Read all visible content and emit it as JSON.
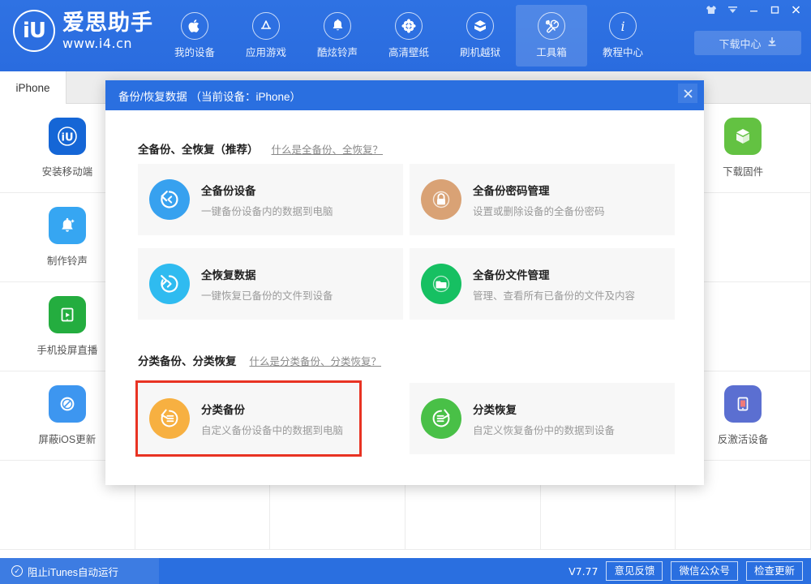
{
  "window": {
    "controls": [
      {
        "name": "skin-icon",
        "label": "皮肤"
      },
      {
        "name": "menu-icon",
        "label": "菜单"
      },
      {
        "name": "minimize-icon",
        "label": "最小化"
      },
      {
        "name": "maximize-icon",
        "label": "最大化"
      },
      {
        "name": "close-icon",
        "label": "关闭"
      }
    ]
  },
  "header": {
    "logo_mark": "iU",
    "brand_cn": "爱思助手",
    "brand_url": "www.i4.cn",
    "nav": [
      {
        "label": "我的设备",
        "icon": "apple-icon",
        "active": false
      },
      {
        "label": "应用游戏",
        "icon": "appstore-icon",
        "active": false
      },
      {
        "label": "酷炫铃声",
        "icon": "bell-icon",
        "active": false
      },
      {
        "label": "高清壁纸",
        "icon": "flower-icon",
        "active": false
      },
      {
        "label": "刷机越狱",
        "icon": "box-open-icon",
        "active": false
      },
      {
        "label": "工具箱",
        "icon": "tools-icon",
        "active": true
      },
      {
        "label": "教程中心",
        "icon": "info-icon",
        "active": false
      }
    ],
    "download_center": "下载中心",
    "download_icon": "download-icon",
    "accent_color": "#2a6fe0"
  },
  "tabs": [
    {
      "label": "iPhone",
      "active": true
    }
  ],
  "toolbox": {
    "tiles": [
      {
        "label": "安装移动端",
        "icon": "i4-app-icon",
        "color": "#1566d6",
        "pos": 0
      },
      {
        "label": "下载固件",
        "icon": "firmware-cube-icon",
        "color": "#63c242",
        "pos": 5
      },
      {
        "label": "制作铃声",
        "icon": "ringtone-bell-icon",
        "color": "#36a6f2",
        "pos": 6
      },
      {
        "label": "手机投屏直播",
        "icon": "screen-cast-icon",
        "color": "#24ad3f",
        "pos": 12
      },
      {
        "label": "屏蔽iOS更新",
        "icon": "block-update-icon",
        "color": "#3d96f0",
        "pos": 18
      },
      {
        "label": "反激活设备",
        "icon": "deactivate-device-icon",
        "color": "#5b6fd1",
        "pos": 23
      }
    ]
  },
  "dialog": {
    "title": "备份/恢复数据  （当前设备：iPhone）",
    "close_icon": "close-icon",
    "sections": [
      {
        "title": "全备份、全恢复（推荐）",
        "link": "什么是全备份、全恢复？",
        "cards": [
          {
            "title": "全备份设备",
            "desc": "一键备份设备内的数据到电脑",
            "icon": "backup-arrow-icon",
            "color": "#37a1ef",
            "highlighted": false
          },
          {
            "title": "全备份密码管理",
            "desc": "设置或删除设备的全备份密码",
            "icon": "lock-icon",
            "color": "#d9a275",
            "highlighted": false
          },
          {
            "title": "全恢复数据",
            "desc": "一键恢复已备份的文件到设备",
            "icon": "restore-arrow-icon",
            "color": "#2fbbf0",
            "highlighted": false
          },
          {
            "title": "全备份文件管理",
            "desc": "管理、查看所有已备份的文件及内容",
            "icon": "folder-icon",
            "color": "#16c062",
            "highlighted": false
          }
        ]
      },
      {
        "title": "分类备份、分类恢复",
        "link": "什么是分类备份、分类恢复？",
        "cards": [
          {
            "title": "分类备份",
            "desc": "自定义备份设备中的数据到电脑",
            "icon": "category-backup-icon",
            "color": "#f7b041",
            "highlighted": true
          },
          {
            "title": "分类恢复",
            "desc": "自定义恢复备份中的数据到设备",
            "icon": "category-restore-icon",
            "color": "#49c047",
            "highlighted": false
          }
        ]
      }
    ],
    "highlight_color": "#e83323"
  },
  "statusbar": {
    "block_itunes": "阻止iTunes自动运行",
    "check_icon": "check-circle-icon",
    "version": "V7.77",
    "buttons": [
      {
        "label": "意见反馈"
      },
      {
        "label": "微信公众号"
      },
      {
        "label": "检查更新"
      }
    ]
  }
}
